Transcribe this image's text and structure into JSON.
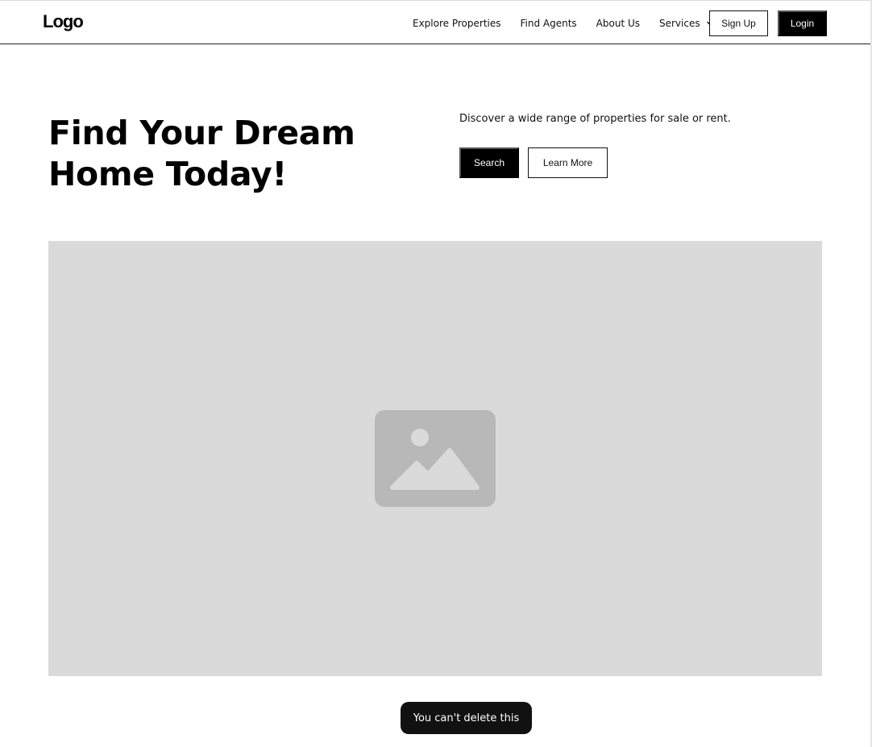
{
  "nav": {
    "logo": "Logo",
    "links": [
      "Explore Properties",
      "Find Agents",
      "About Us"
    ],
    "services_label": "Services",
    "sign_up_label": "Sign Up",
    "login_label": "Login"
  },
  "hero": {
    "title": "Find Your Dream Home Today!",
    "description": "Discover a wide range of properties for sale or rent.",
    "search_label": "Search",
    "learn_more_label": "Learn More"
  },
  "media": {
    "icon": "image-icon",
    "placeholder_color": "#dadada"
  },
  "toast": {
    "message": "You can't delete this"
  },
  "colors": {
    "primary": "#000000",
    "background": "#ffffff"
  }
}
